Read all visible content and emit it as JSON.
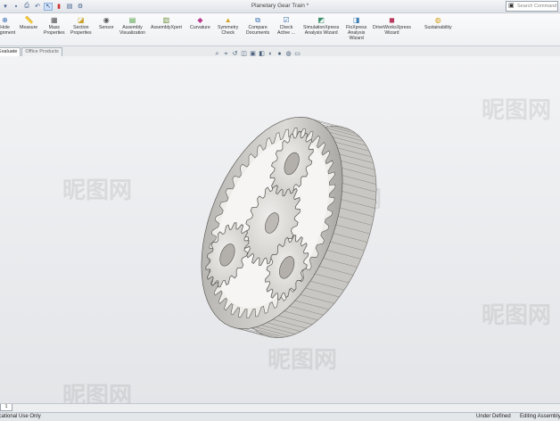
{
  "window": {
    "title": "Planetary Gear Train *"
  },
  "search": {
    "placeholder": "Search Command"
  },
  "ribbon": {
    "items": [
      {
        "label": "Hole\nAlignment",
        "icon": "hole-alignment-icon",
        "glyph": "⊕",
        "color": "#3a6fb5"
      },
      {
        "label": "Measure",
        "icon": "measure-icon",
        "glyph": "📏",
        "color": "#777"
      },
      {
        "label": "Mass\nProperties",
        "icon": "mass-properties-icon",
        "glyph": "▦",
        "color": "#555"
      },
      {
        "label": "Section\nProperties",
        "icon": "section-properties-icon",
        "glyph": "◪",
        "color": "#c9a227"
      },
      {
        "label": "Sensor",
        "icon": "sensor-icon",
        "glyph": "◉",
        "color": "#555"
      },
      {
        "label": "Assembly\nVisualization",
        "icon": "assembly-visualization-icon",
        "glyph": "▤",
        "color": "#4a9a3f"
      },
      {
        "label": "AssemblyXpert",
        "icon": "assemblyxpert-icon",
        "glyph": "▥",
        "color": "#6a8f3a"
      },
      {
        "label": "Curvature",
        "icon": "curvature-icon",
        "glyph": "◆",
        "color": "#b83a8e"
      },
      {
        "label": "Symmetry\nCheck",
        "icon": "symmetry-check-icon",
        "glyph": "▲",
        "color": "#d2a21f"
      },
      {
        "label": "Compare\nDocuments",
        "icon": "compare-documents-icon",
        "glyph": "⧉",
        "color": "#3a6fb5"
      },
      {
        "label": "Check\nActive ...",
        "icon": "check-active-icon",
        "glyph": "☑",
        "color": "#3a6fb5"
      },
      {
        "label": "SimulationXpress\nAnalysis Wizard",
        "icon": "simulationxpress-icon",
        "glyph": "◩",
        "color": "#3a8f6a"
      },
      {
        "label": "FloXpress\nAnalysis\nWizard",
        "icon": "floxpress-icon",
        "glyph": "◨",
        "color": "#3a7fb5"
      },
      {
        "label": "DriveWorksXpress\nWizard",
        "icon": "driveworksxpress-icon",
        "glyph": "◼",
        "color": "#b83a5e"
      },
      {
        "label": "Sustainability",
        "icon": "sustainability-icon",
        "glyph": "◍",
        "color": "#d2a21f"
      }
    ]
  },
  "tabs": [
    {
      "label": "Evaluate",
      "active": true
    },
    {
      "label": "Office Products",
      "active": false
    }
  ],
  "sheet": {
    "tab_label": "1"
  },
  "status": {
    "left": "Educational Use Only",
    "middle": "Under Defined",
    "right": "Editing Assembly"
  },
  "watermark": "昵图网"
}
